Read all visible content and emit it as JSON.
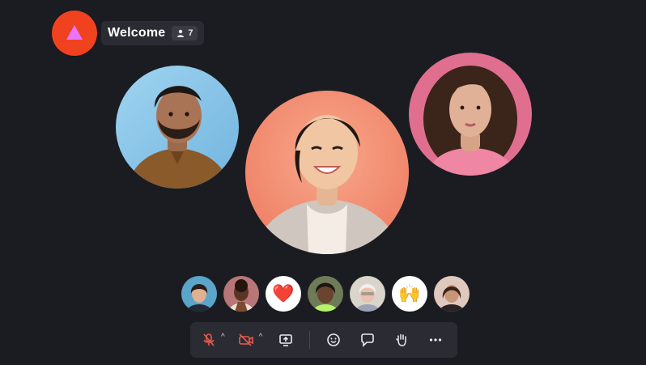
{
  "room": {
    "title": "Welcome",
    "participant_count": "7",
    "logo_icon": "triangle-icon",
    "colors": {
      "logo_bg": "#f0421f",
      "logo_triangle": "#e874ff",
      "chip_bg": "#2b2c33"
    }
  },
  "participants": [
    {
      "name_icon": "avatar",
      "bg": "#8fc8eb"
    },
    {
      "name_icon": "avatar",
      "bg": "#f08c6f"
    },
    {
      "name_icon": "avatar",
      "bg": "#e7718f"
    }
  ],
  "reactions": {
    "items": [
      {
        "kind": "avatar",
        "bg": "#5aa5c9"
      },
      {
        "kind": "avatar",
        "bg": "#b87678"
      },
      {
        "kind": "emoji",
        "glyph": "❤️"
      },
      {
        "kind": "avatar",
        "bg": "#6d7b56"
      },
      {
        "kind": "avatar",
        "bg": "#d9d5cc"
      },
      {
        "kind": "emoji",
        "glyph": "🙌"
      },
      {
        "kind": "avatar",
        "bg": "#dfc8bd"
      }
    ]
  },
  "toolbar": {
    "icons": [
      "mic-off-icon",
      "camera-off-icon",
      "share-screen-icon",
      "emoji-icon",
      "chat-icon",
      "raise-hand-icon",
      "more-icon"
    ],
    "muted_color": "#e65a4f"
  }
}
